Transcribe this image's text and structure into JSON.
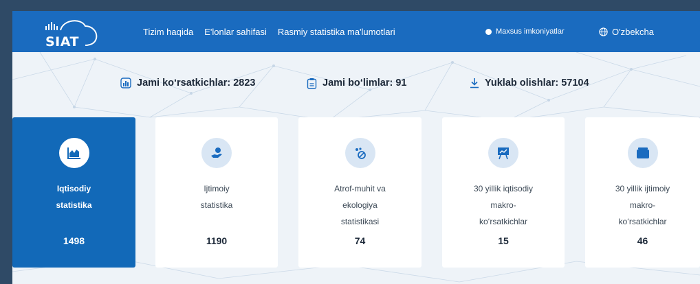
{
  "header": {
    "logo_text": "SIAT",
    "nav": [
      "Tizim haqida",
      "E'lonlar sahifasi",
      "Rasmiy statistika ma'lumotlari"
    ],
    "accessibility_label": "Maxsus imkoniyatlar",
    "language_label": "O'zbekcha"
  },
  "stats": [
    {
      "label": "Jami ko‘rsatkichlar: 2823",
      "icon": "chart-icon"
    },
    {
      "label": "Jami bo‘limlar: 91",
      "icon": "clipboard-icon"
    },
    {
      "label": "Yuklab olishlar: 57104",
      "icon": "download-icon"
    }
  ],
  "cards": [
    {
      "label_lines": [
        "Iqtisodiy",
        "statistika"
      ],
      "count": "1498",
      "icon": "area-chart-icon",
      "active": true
    },
    {
      "label_lines": [
        "Ijtimoiy",
        "statistika"
      ],
      "count": "1190",
      "icon": "hand-coin-icon",
      "active": false
    },
    {
      "label_lines": [
        "Atrof-muhit va",
        "ekologiya",
        "statistikasi"
      ],
      "count": "74",
      "icon": "eco-leaf-icon",
      "active": false
    },
    {
      "label_lines": [
        "30 yillik iqtisodiy",
        "makro-",
        "ko‘rsatkichlar"
      ],
      "count": "15",
      "icon": "presentation-board-icon",
      "active": false
    },
    {
      "label_lines": [
        "30 yillik ijtimoiy",
        "makro-",
        "ko‘rsatkichlar"
      ],
      "count": "46",
      "icon": "folder-icon",
      "active": false
    }
  ],
  "colors": {
    "header_bg": "#1a6bbf",
    "active_card_bg": "#1269b8",
    "page_bg": "#eef3f8",
    "outer_bg": "#2f4a66",
    "icon_circle_bg": "#d9e6f4",
    "icon_color": "#1a6bbf"
  }
}
